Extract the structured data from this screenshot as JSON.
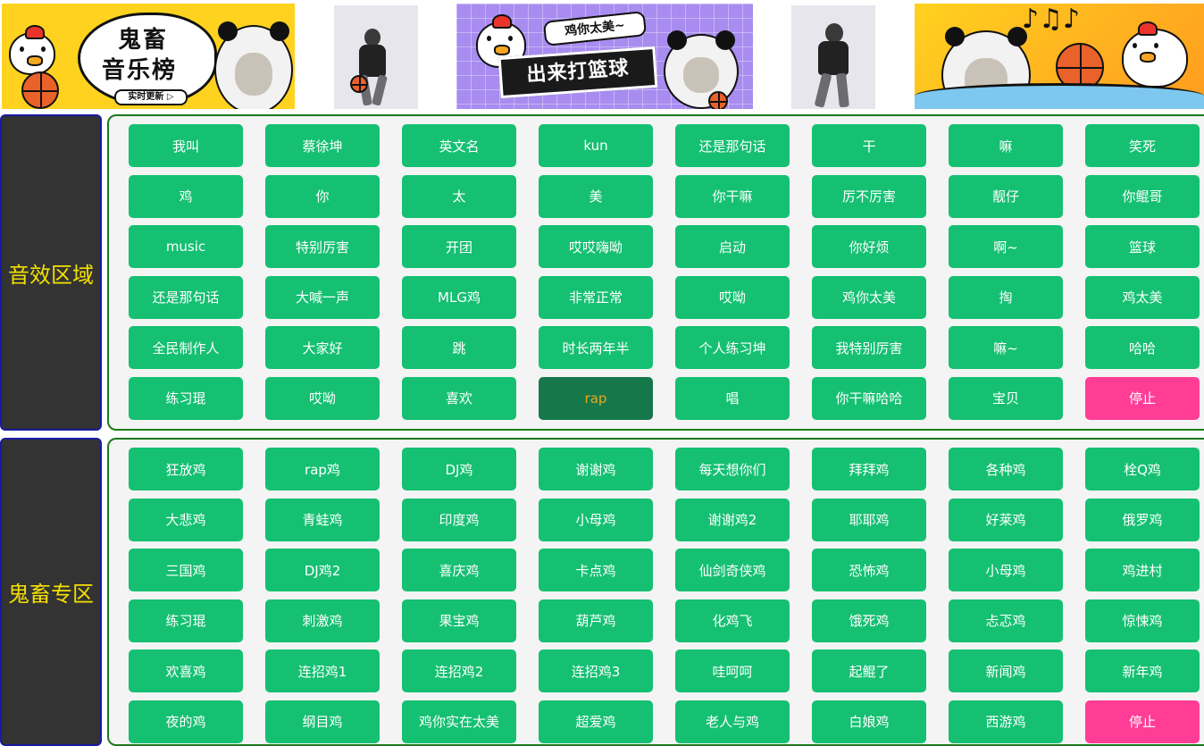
{
  "banner": {
    "b1_title_line1": "鬼畜",
    "b1_title_line2": "音乐榜",
    "b1_tag": "实时更新 ▷",
    "b3_sign_top": "鸡你太美~",
    "b3_sign_main": "出来打篮球",
    "b5_notes": "♪♫♪"
  },
  "sections": [
    {
      "title": "音效区域",
      "buttons": [
        "我叫",
        "蔡徐坤",
        "英文名",
        "kun",
        "还是那句话",
        "干",
        "嘛",
        "笑死",
        "鸡",
        "你",
        "太",
        "美",
        "你干嘛",
        "厉不厉害",
        "靓仔",
        "你鲲哥",
        "music",
        "特别厉害",
        "开团",
        "哎哎嗨呦",
        "启动",
        "你好烦",
        "啊~",
        "篮球",
        "还是那句话",
        "大喊一声",
        "MLG鸡",
        "非常正常",
        "哎呦",
        "鸡你太美",
        "掏",
        "鸡太美",
        "全民制作人",
        "大家好",
        "跳",
        "时长两年半",
        "个人练习坤",
        "我特别厉害",
        "嘛~",
        "哈哈",
        "练习琨",
        "哎呦",
        "喜欢",
        "rap",
        "唱",
        "你干嘛哈哈",
        "宝贝",
        "停止"
      ],
      "active_index": 43,
      "stop_index": 47
    },
    {
      "title": "鬼畜专区",
      "buttons": [
        "狂放鸡",
        "rap鸡",
        "DJ鸡",
        "谢谢鸡",
        "每天想你们",
        "拜拜鸡",
        "各种鸡",
        "栓Q鸡",
        "大悲鸡",
        "青蛙鸡",
        "印度鸡",
        "小母鸡",
        "谢谢鸡2",
        "耶耶鸡",
        "好莱鸡",
        "俄罗鸡",
        "三国鸡",
        "DJ鸡2",
        "喜庆鸡",
        "卡点鸡",
        "仙剑奇侠鸡",
        "恐怖鸡",
        "小母鸡",
        "鸡进村",
        "练习琨",
        "刺激鸡",
        "果宝鸡",
        "葫芦鸡",
        "化鸡飞",
        "饿死鸡",
        "忐忑鸡",
        "惊悚鸡",
        "欢喜鸡",
        "连招鸡1",
        "连招鸡2",
        "连招鸡3",
        "哇呵呵",
        "起鲲了",
        "新闻鸡",
        "新年鸡",
        "夜的鸡",
        "纲目鸡",
        "鸡你实在太美",
        "超爱鸡",
        "老人与鸡",
        "白娘鸡",
        "西游鸡",
        "停止"
      ],
      "active_index": -1,
      "stop_index": 47
    }
  ]
}
